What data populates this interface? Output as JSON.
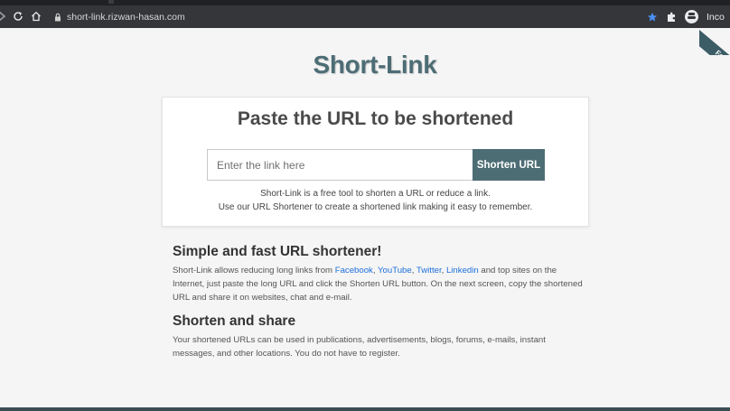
{
  "browser": {
    "url": "short-link.rizwan-hasan.com",
    "profile_label": "Inco"
  },
  "ribbon": {
    "text": "Fo"
  },
  "page": {
    "brand": "Short-Link",
    "card": {
      "title": "Paste the URL to be shortened",
      "input_placeholder": "Enter the link here",
      "button_label": "Shorten URL",
      "desc_line1": "Short-Link is a free tool to shorten a URL or reduce a link.",
      "desc_line2": "Use our URL Shortener to create a shortened link making it easy to remember."
    },
    "section1": {
      "heading": "Simple and fast URL shortener!",
      "text_before": "Short-Link allows reducing long links from ",
      "links": [
        "Facebook",
        "YouTube",
        "Twitter",
        "Linkedin"
      ],
      "text_after": " and top sites on the Internet, just paste the long URL and click the Shorten URL button. On the next screen, copy the shortened URL and share it on websites, chat and e-mail."
    },
    "section2": {
      "heading": "Shorten and share",
      "text": "Your shortened URLs can be used in publications, advertisements, blogs, forums, e-mails, instant messages, and other locations. You do not have to register."
    }
  },
  "colors": {
    "brand": "#4d6d75",
    "link": "#1e6fd9",
    "chrome": "#35363a",
    "star": "#4a90f0"
  },
  "icons": [
    "forward-icon",
    "reload-icon",
    "home-icon",
    "lock-icon",
    "star-icon",
    "extensions-icon",
    "incognito-icon"
  ]
}
